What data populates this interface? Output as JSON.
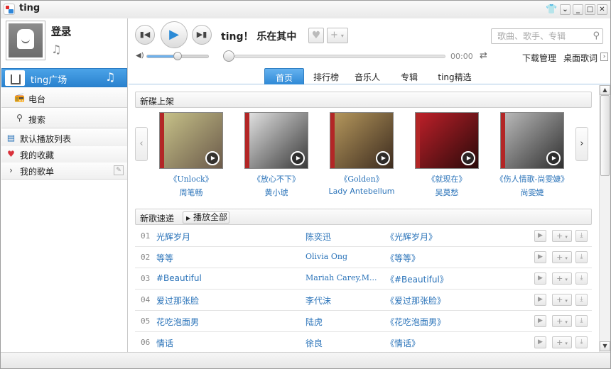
{
  "app": {
    "title": "ting",
    "window_buttons": {
      "minimize": "_",
      "maximize": "□",
      "close": "✕",
      "menu": "⌄",
      "skin": "👕"
    }
  },
  "user": {
    "login_label": "登录"
  },
  "sidebar": {
    "ting_square": "ting广场",
    "radio": "电台",
    "search": "搜索",
    "default_playlist": "默认播放列表",
    "favorites": "我的收藏",
    "my_playlists": "我的歌单"
  },
  "player": {
    "now_playing": "ting！ 乐在其中",
    "time": "00:00",
    "volume_percent": 50,
    "progress_percent": 0
  },
  "search": {
    "placeholder": "歌曲、歌手、专辑"
  },
  "toolbar": {
    "download_manager": "下载管理",
    "desktop_lyrics": "桌面歌词"
  },
  "tabs": [
    {
      "label": "首页",
      "active": true
    },
    {
      "label": "排行榜",
      "active": false
    },
    {
      "label": "音乐人",
      "active": false
    },
    {
      "label": "专辑",
      "active": false
    },
    {
      "label": "ting精选",
      "active": false
    }
  ],
  "new_albums": {
    "header": "新碟上架",
    "items": [
      {
        "name": "《Unlock》",
        "artist": "周笔畅",
        "colors": [
          "#c9c48a",
          "#6b5a4a"
        ]
      },
      {
        "name": "《放心不下》",
        "artist": "黄小琥",
        "colors": [
          "#e6e6e6",
          "#3a3a3a"
        ]
      },
      {
        "name": "《Golden》",
        "artist": "Lady Antebellum",
        "colors": [
          "#b89a5e",
          "#3d2c1f"
        ]
      },
      {
        "name": "《就现在》",
        "artist": "吴莫愁",
        "colors": [
          "#c0202a",
          "#2a0a0a"
        ]
      },
      {
        "name": "《伤人情歌-尚雯婕》",
        "artist": "尚雯婕",
        "colors": [
          "#bdbdbd",
          "#303030"
        ]
      }
    ]
  },
  "new_songs": {
    "header": "新歌速递",
    "play_all": "播放全部",
    "rows": [
      {
        "num": "01",
        "title": "光辉岁月",
        "artist": "陈奕迅",
        "album": "《光辉岁月》"
      },
      {
        "num": "02",
        "title": "等等",
        "artist": "Olivia Ong",
        "album": "《等等》"
      },
      {
        "num": "03",
        "title": "#Beautiful",
        "artist": "Mariah Carey,M...",
        "album": "《#Beautiful》"
      },
      {
        "num": "04",
        "title": "爱过那张脸",
        "artist": "李代沫",
        "album": "《爱过那张脸》"
      },
      {
        "num": "05",
        "title": "花吃泡面男",
        "artist": "陆虎",
        "album": "《花吃泡面男》"
      },
      {
        "num": "06",
        "title": "情话",
        "artist": "徐良",
        "album": "《情话》"
      }
    ]
  }
}
